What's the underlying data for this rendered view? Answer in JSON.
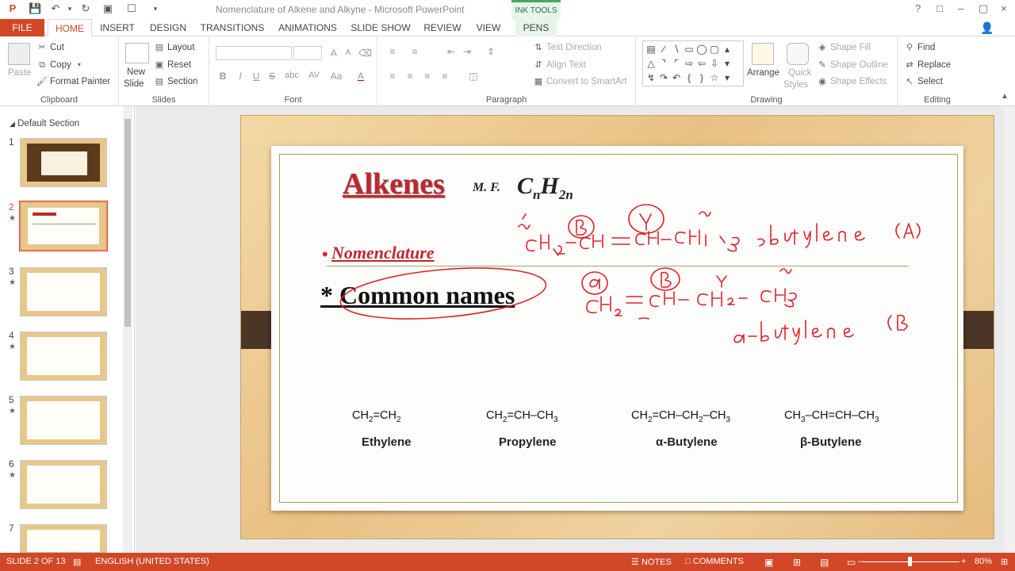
{
  "app": {
    "title": "Nomenclature of Alkene and Alkyne - Microsoft PowerPoint",
    "ink_tools": "INK TOOLS",
    "window_controls": [
      "?",
      "□",
      "–",
      "▢",
      "×"
    ]
  },
  "tabs": [
    {
      "label": "FILE"
    },
    {
      "label": "HOME"
    },
    {
      "label": "INSERT"
    },
    {
      "label": "DESIGN"
    },
    {
      "label": "TRANSITIONS"
    },
    {
      "label": "ANIMATIONS"
    },
    {
      "label": "SLIDE SHOW"
    },
    {
      "label": "REVIEW"
    },
    {
      "label": "VIEW"
    },
    {
      "label": "PENS"
    }
  ],
  "ribbon": {
    "clipboard": {
      "paste": "Paste",
      "cut": "Cut",
      "copy": "Copy",
      "format_painter": "Format Painter",
      "label": "Clipboard"
    },
    "slides": {
      "new_slide_1": "New",
      "new_slide_2": "Slide",
      "layout": "Layout",
      "reset": "Reset",
      "section": "Section",
      "label": "Slides"
    },
    "font": {
      "label": "Font",
      "bold": "B",
      "italic": "I",
      "underline": "U",
      "strike": "S",
      "shadow": "abc",
      "spacing": "AV",
      "case": "Aa",
      "color": "A"
    },
    "paragraph": {
      "label": "Paragraph",
      "text_direction": "Text Direction",
      "align_text": "Align Text",
      "convert_smartart": "Convert to SmartArt"
    },
    "drawing": {
      "label": "Drawing",
      "arrange": "Arrange",
      "quick_styles_1": "Quick",
      "quick_styles_2": "Styles",
      "shape_fill": "Shape Fill",
      "shape_outline": "Shape Outline",
      "shape_effects": "Shape Effects"
    },
    "editing": {
      "label": "Editing",
      "find": "Find",
      "replace": "Replace",
      "select": "Select"
    }
  },
  "slides_pane": {
    "section": "Default Section",
    "thumbs": [
      {
        "num": "1",
        "star": ""
      },
      {
        "num": "2",
        "star": "★"
      },
      {
        "num": "3",
        "star": "★"
      },
      {
        "num": "4",
        "star": "★"
      },
      {
        "num": "5",
        "star": "★"
      },
      {
        "num": "6",
        "star": "★"
      },
      {
        "num": "7",
        "star": ""
      }
    ]
  },
  "slide": {
    "title": "Alkenes",
    "mf_label": "M. F.",
    "formula_c": "C",
    "formula_n": "n",
    "formula_h": "H",
    "formula_2n": "2n",
    "bullet_heading": "Nomenclature",
    "subheading": "* Common names",
    "compounds": [
      {
        "formula": [
          "CH",
          "2",
          "=CH",
          "2"
        ],
        "name": "Ethylene"
      },
      {
        "formula": [
          "CH",
          "2",
          "=CH–CH",
          "3"
        ],
        "name": "Propylene"
      },
      {
        "formula": [
          "CH",
          "2",
          "=CH–CH",
          "2",
          "–CH",
          "3"
        ],
        "name": "α-Butylene"
      },
      {
        "formula": [
          "CH",
          "3",
          "–CH=CH–CH",
          "3"
        ],
        "name": "β-Butylene"
      }
    ]
  },
  "statusbar": {
    "slide_info": "SLIDE 2 OF 13",
    "language": "ENGLISH (UNITED STATES)",
    "notes": "NOTES",
    "comments": "COMMENTS",
    "zoom": "80%"
  }
}
